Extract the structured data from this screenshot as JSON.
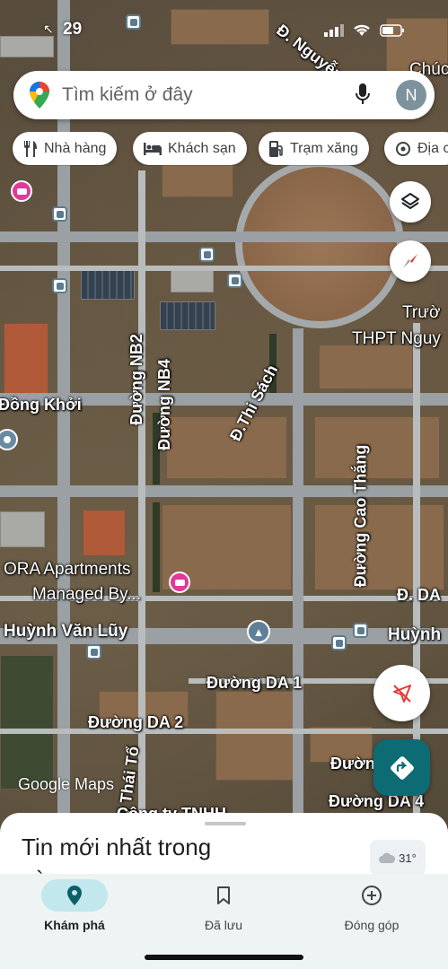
{
  "status_bar": {
    "time": "29"
  },
  "search": {
    "placeholder": "Tìm kiếm ở đây",
    "avatar_initial": "N"
  },
  "chips": [
    {
      "label": "Nhà hàng",
      "icon": "restaurant-icon"
    },
    {
      "label": "Khách sạn",
      "icon": "hotel-icon"
    },
    {
      "label": "Trạm xăng",
      "icon": "gas-station-icon"
    },
    {
      "label": "Địa c",
      "icon": "attraction-icon"
    }
  ],
  "map": {
    "labels": {
      "nguyen": "Đ. Nguyễn",
      "chuc": "Chúc",
      "truong": "Trườ",
      "thpt": "THPT Nguy",
      "nb2": "Đường NB2",
      "nb4": "Đường NB4",
      "thi_sach": "Đ.Thi Sách",
      "cao_thang": "Đường Cao Thắng",
      "dong_khoi": "Đồng Khởi",
      "ora_line1": "ORA Apartments",
      "ora_line2": "Managed By...",
      "d_da": "Đ. DA",
      "huynh_van_luy": "Huỳnh Văn Lũy",
      "huynh_right": "Huỳnh",
      "da1": "Đường DA 1",
      "da2": "Đường DA 2",
      "ly_thai_to": "Đường Lý Thái Tổ",
      "duong_right": "Đườn",
      "da4": "Đường DA 4",
      "tnhh": "Công ty TNHH"
    },
    "watermark": "Google Maps"
  },
  "sheet": {
    "title": "Tin mới nhất trong vùng",
    "temperature": "31°"
  },
  "nav": [
    {
      "label": "Khám phá",
      "icon": "explore-pin-icon",
      "active": true
    },
    {
      "label": "Đã lưu",
      "icon": "bookmark-icon",
      "active": false
    },
    {
      "label": "Đóng góp",
      "icon": "add-circle-icon",
      "active": false
    }
  ]
}
